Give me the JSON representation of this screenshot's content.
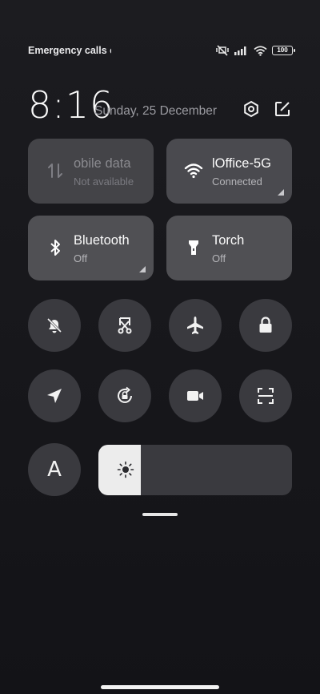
{
  "status_bar": {
    "carrier_text": "Emergency calls o",
    "battery": "100",
    "icons": [
      "mute-vibrate-icon",
      "signal-icon",
      "wifi-icon",
      "battery-icon"
    ]
  },
  "header": {
    "time": "8:16",
    "date": "Sunday, 25 December",
    "icons": [
      "settings-icon",
      "edit-icon"
    ]
  },
  "tiles": [
    {
      "title": "obile data",
      "subtitle": "Not available",
      "icon": "mobile-data-icon",
      "active": false
    },
    {
      "title": "lOffice-5G",
      "subtitle": "Connected",
      "icon": "wifi-icon",
      "active": true
    },
    {
      "title": "Bluetooth",
      "subtitle": "Off",
      "icon": "bluetooth-icon",
      "active": false
    },
    {
      "title": "Torch",
      "subtitle": "Off",
      "icon": "torch-icon",
      "active": false
    }
  ],
  "round_toggles": [
    {
      "name": "mute-toggle",
      "icon": "bell-off-icon"
    },
    {
      "name": "screenshot-toggle",
      "icon": "scissors-icon"
    },
    {
      "name": "airplane-mode-toggle",
      "icon": "airplane-icon"
    },
    {
      "name": "lock-screen-toggle",
      "icon": "lock-icon"
    },
    {
      "name": "location-toggle",
      "icon": "navigation-arrow-icon"
    },
    {
      "name": "rotation-lock-toggle",
      "icon": "rotate-lock-icon"
    },
    {
      "name": "screen-recorder-toggle",
      "icon": "video-camera-icon"
    },
    {
      "name": "scanner-toggle",
      "icon": "scan-icon"
    }
  ],
  "auto_brightness": {
    "label": "A"
  },
  "brightness": {
    "level_fraction": 0.22,
    "icon": "sun-icon"
  },
  "colors": {
    "background": "#18181c",
    "tile": "#505054",
    "round": "#3a3a3f",
    "fill": "#ececec"
  }
}
